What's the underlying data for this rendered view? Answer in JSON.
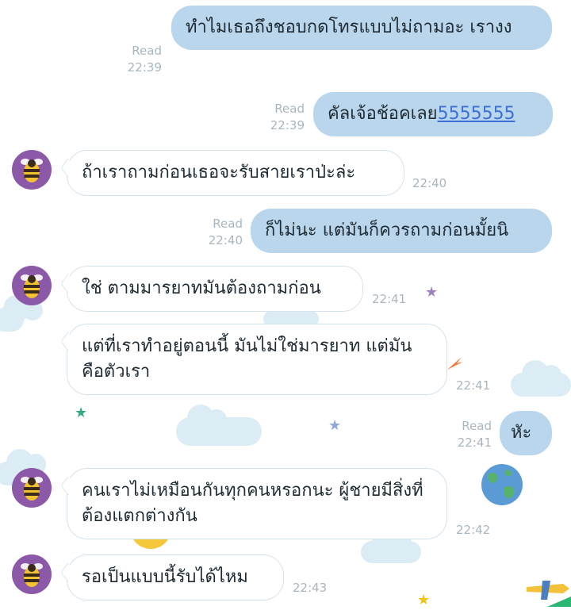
{
  "messages": [
    {
      "dir": "out",
      "text": "ทำไมเธอถึงชอบกดโทรแบบไม่ถามอะ เรางง",
      "read": "Read",
      "time": "22:39"
    },
    {
      "dir": "out",
      "text": "คัลเจ้อช้อคเลย",
      "link": "5555555",
      "read": "Read",
      "time": "22:39"
    },
    {
      "dir": "in",
      "text": "ถ้าเราถามก่อนเธอจะรับสายเราป่ะล่ะ",
      "time": "22:40"
    },
    {
      "dir": "out",
      "text": "ก็ไม่นะ แต่มันก็ควรถามก่อนมั้ยนิ",
      "read": "Read",
      "time": "22:40"
    },
    {
      "dir": "in",
      "text": "ใช่ ตามมารยาทมันต้องถามก่อน",
      "time": "22:41"
    },
    {
      "dir": "in",
      "text": "แต่ที่เราทำอยู่ตอนนี้ มันไม่ใช่มารยาท แต่มันคือตัวเรา",
      "time": "22:41"
    },
    {
      "dir": "out",
      "text": "หัะ",
      "read": "Read",
      "time": "22:41"
    },
    {
      "dir": "in",
      "text": "คนเราไม่เหมือนกันทุกคนหรอกนะ ผู้ชายมีสิ่งที่ต้องแตกต่างกัน",
      "time": "22:42"
    },
    {
      "dir": "in",
      "text": "รอเป็นแบบนี้รับได้ไหม",
      "time": "22:43"
    }
  ],
  "avatar_icon": "bee-avatar-icon",
  "colors": {
    "outgoing": "#b9d6ed",
    "incoming": "#ffffff",
    "avatar": "#8b59a8",
    "meta": "#a9b6c0",
    "link": "#3d6fd9"
  }
}
